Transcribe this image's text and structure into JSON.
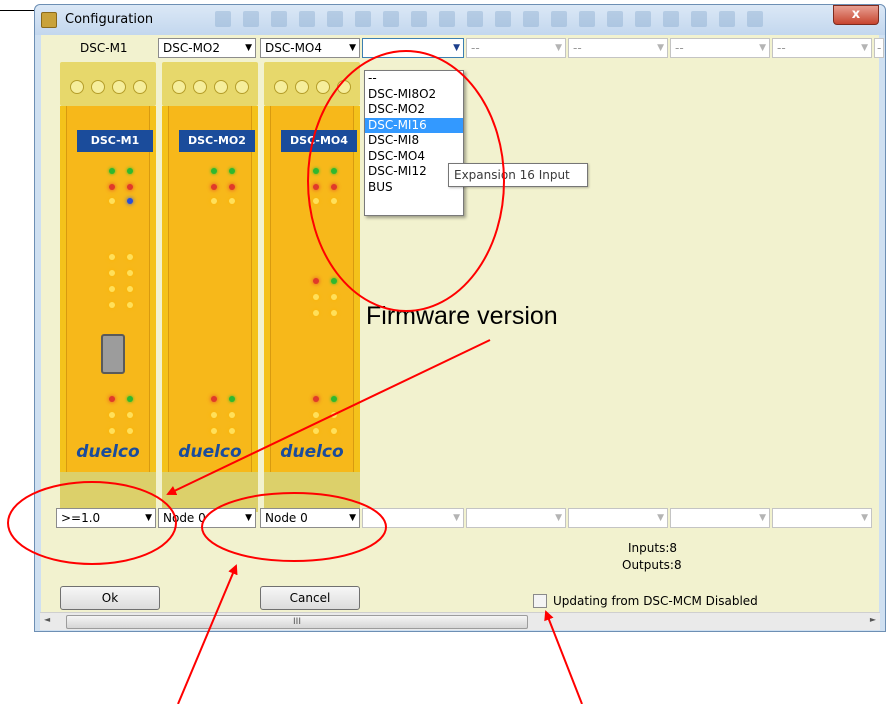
{
  "window": {
    "title": "Configuration",
    "close_glyph": "x"
  },
  "top": {
    "main_module_label": "DSC-M1",
    "selectors": [
      {
        "value": "DSC-MO2",
        "arrow": "▼"
      },
      {
        "value": "DSC-MO4",
        "arrow": "▼"
      },
      {
        "value": "",
        "arrow": "▼"
      },
      {
        "value": "--",
        "arrow": "▼"
      },
      {
        "value": "--",
        "arrow": "▼"
      },
      {
        "value": "--",
        "arrow": "▼"
      },
      {
        "value": "--",
        "arrow": "▼"
      },
      {
        "value": "--",
        "arrow": "▼"
      }
    ]
  },
  "modules": [
    {
      "label": "DSC-M1",
      "brand": "duelco"
    },
    {
      "label": "DSC-MO2",
      "brand": "duelco"
    },
    {
      "label": "DSC-MO4",
      "brand": "duelco"
    }
  ],
  "dropdown": {
    "options": [
      "--",
      "DSC-MI8O2",
      "DSC-MO2",
      "DSC-MI16",
      "DSC-MI8",
      "DSC-MO4",
      "DSC-MI12",
      "BUS"
    ],
    "selected_index": 3,
    "tooltip": "Expansion 16 Input"
  },
  "bottom": {
    "firmware": {
      "value": ">=1.0",
      "arrow": "▼"
    },
    "nodes": [
      {
        "value": "Node 0",
        "arrow": "▼"
      },
      {
        "value": "Node 0",
        "arrow": "▼"
      }
    ],
    "inputs_label": "Inputs:8",
    "outputs_label": "Outputs:8",
    "ok_label": "Ok",
    "cancel_label": "Cancel",
    "checkbox_label": "Updating from DSC-MCM Disabled",
    "checkbox_checked": false
  },
  "scrollbar": {
    "grip": "III",
    "left_arrow": "◄",
    "right_arrow": "►"
  },
  "annotation": {
    "text": "Firmware version",
    "color": "#ff0000"
  }
}
